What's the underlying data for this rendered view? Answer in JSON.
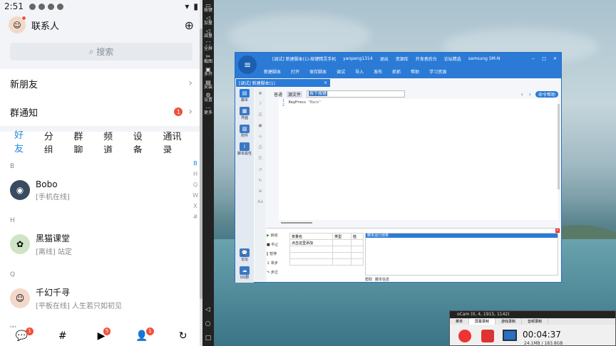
{
  "phone": {
    "status": {
      "time": "2:51",
      "battery_icon": "battery-icon",
      "wifi_icon": "wifi-icon"
    },
    "header": {
      "title": "联系人"
    },
    "search": {
      "placeholder": "搜索"
    },
    "rows": [
      {
        "label": "新朋友",
        "badge": ""
      },
      {
        "label": "群通知",
        "badge": "1"
      }
    ],
    "tabs": [
      "好友",
      "分组",
      "群聊",
      "频道",
      "设备",
      "通讯录"
    ],
    "contacts": [
      {
        "section": "B",
        "name": "Bobo",
        "status": "[手机在线]"
      },
      {
        "section": "H",
        "name": "黑猫课堂",
        "status": "[离线] 站定"
      },
      {
        "section": "Q",
        "name": "千幻千寻",
        "status": "[平板在线] 人生若只如初见"
      },
      {
        "section": "W",
        "name": "",
        "status": ""
      }
    ],
    "index": [
      "B",
      "H",
      "Q",
      "W",
      "X",
      "#"
    ],
    "bottom_nav": [
      {
        "icon": "message-icon",
        "badge": "1"
      },
      {
        "icon": "channel-icon",
        "badge": ""
      },
      {
        "icon": "video-icon",
        "badge": "5"
      },
      {
        "icon": "contacts-icon",
        "badge": "1"
      },
      {
        "icon": "moments-icon",
        "badge": ""
      }
    ]
  },
  "strip": [
    "按键",
    "加量",
    "减量",
    "全屏",
    "截图",
    "多开",
    "安装",
    "设置",
    "更多"
  ],
  "ide": {
    "title": "[调试] 新建脚本(1)-按键精灵手机",
    "user": "yanpeng1314",
    "title_links": [
      "退出",
      "资源库",
      "开发者后台",
      "论坛精选"
    ],
    "device": "samsung SM-N",
    "toolbar": [
      "新建脚本",
      "打开",
      "保存脚本",
      "调试",
      "导入",
      "发布",
      "抓抓",
      "帮助",
      "学习资源"
    ],
    "file_tab": "[调试] 新建脚本(1)",
    "side": [
      "脚本",
      "界面",
      "附件",
      "脚本属性"
    ],
    "side_bottom": [
      "论坛",
      "QQ群"
    ],
    "editor_tools": {
      "normal": "普通",
      "source": "源文件",
      "cmd": "按下按键",
      "help": "命令帮助"
    },
    "code": {
      "line1": "1",
      "line2": "2",
      "keyword": "KeyPress",
      "arg": "\"Back\""
    },
    "debug_buttons": [
      "启动",
      "中止",
      "暂停",
      "单步",
      "步过"
    ],
    "var_table": {
      "headers": [
        "变量名",
        "类型",
        "值"
      ],
      "rows": [
        [
          "点击这里添加",
          "",
          ""
        ]
      ]
    },
    "output_header": "脚本运行结果",
    "output_tabs": [
      "帮助",
      "脚本信息"
    ]
  },
  "ocam": {
    "title": "oCam (0, 4, 1915, 1142)",
    "tabs": [
      "菜单",
      "屏幕录制",
      "游戏录制",
      "音频录制"
    ],
    "time": "00:04:37",
    "size": "24.1MB / 183.8GB"
  }
}
